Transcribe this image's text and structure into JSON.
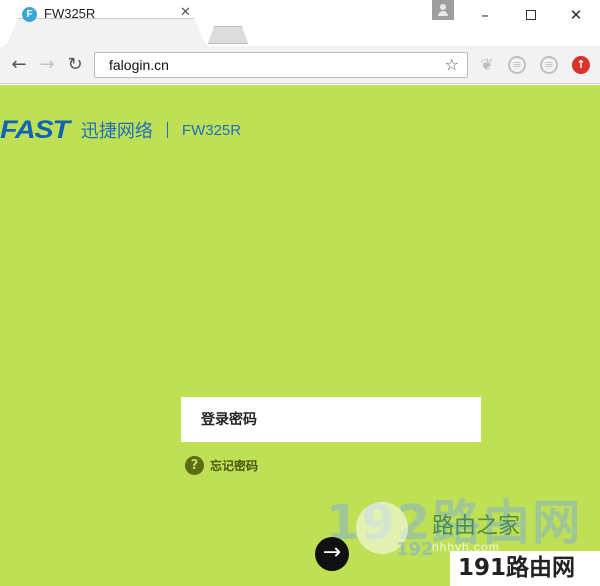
{
  "browser": {
    "tab_title": "FW325R",
    "tab_favicon_letter": "F",
    "url": "falogin.cn",
    "window_min": "–",
    "window_close": "✕",
    "tab_close": "✕",
    "back": "←",
    "forward": "→",
    "reload": "↻",
    "star": "☆"
  },
  "header": {
    "logo": "FAST",
    "brand_name": "迅捷网络",
    "model": "FW325R"
  },
  "login": {
    "password_placeholder": "登录密码",
    "forgot_icon": "?",
    "forgot_label": "忘记密码",
    "submit_arrow": "→"
  },
  "watermark": {
    "big": "192路由网",
    "mid": "路由之家",
    "url": "nhhyh.com",
    "small": "192",
    "bottom": "191路由网"
  },
  "colors": {
    "page_background": "#bfdf55",
    "brand_blue": "#1f6fbf",
    "forgot_icon_bg": "#5d6b12"
  }
}
